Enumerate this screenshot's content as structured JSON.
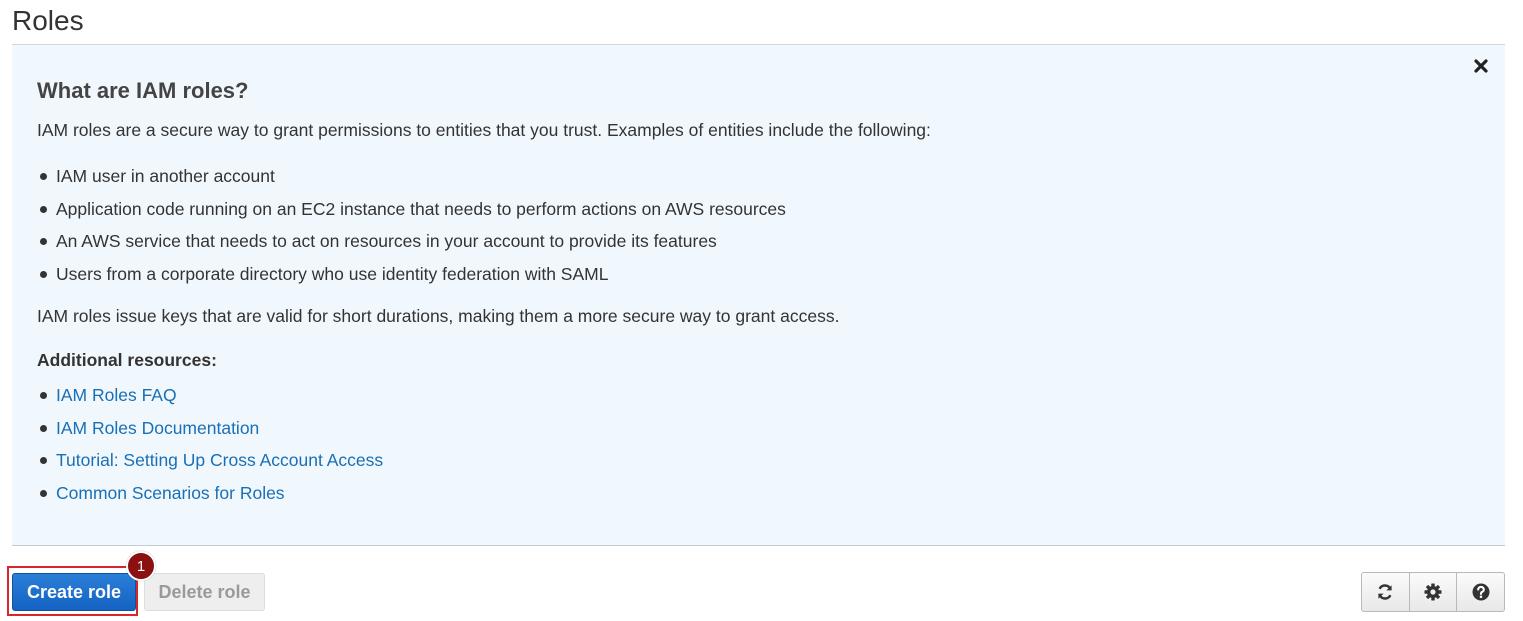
{
  "page": {
    "title": "Roles"
  },
  "info_panel": {
    "heading": "What are IAM roles?",
    "intro": "IAM roles are a secure way to grant permissions to entities that you trust. Examples of entities include the following:",
    "entities": [
      "IAM user in another account",
      "Application code running on an EC2 instance that needs to perform actions on AWS resources",
      "An AWS service that needs to act on resources in your account to provide its features",
      "Users from a corporate directory who use identity federation with SAML"
    ],
    "outro": "IAM roles issue keys that are valid for short durations, making them a more secure way to grant access.",
    "resources_heading": "Additional resources:",
    "resources": [
      "IAM Roles FAQ",
      "IAM Roles Documentation",
      "Tutorial: Setting Up Cross Account Access",
      "Common Scenarios for Roles"
    ],
    "close_icon": "close-icon"
  },
  "toolbar": {
    "create_label": "Create role",
    "delete_label": "Delete role",
    "step_number": "1",
    "icons": [
      "refresh-icon",
      "gear-icon",
      "help-icon"
    ]
  },
  "colors": {
    "primary_button": "#1f6fcd",
    "link": "#1a6fb5",
    "panel_background": "#f1f8fd",
    "highlight_border": "#d9262c",
    "step_badge": "#8b1010"
  }
}
